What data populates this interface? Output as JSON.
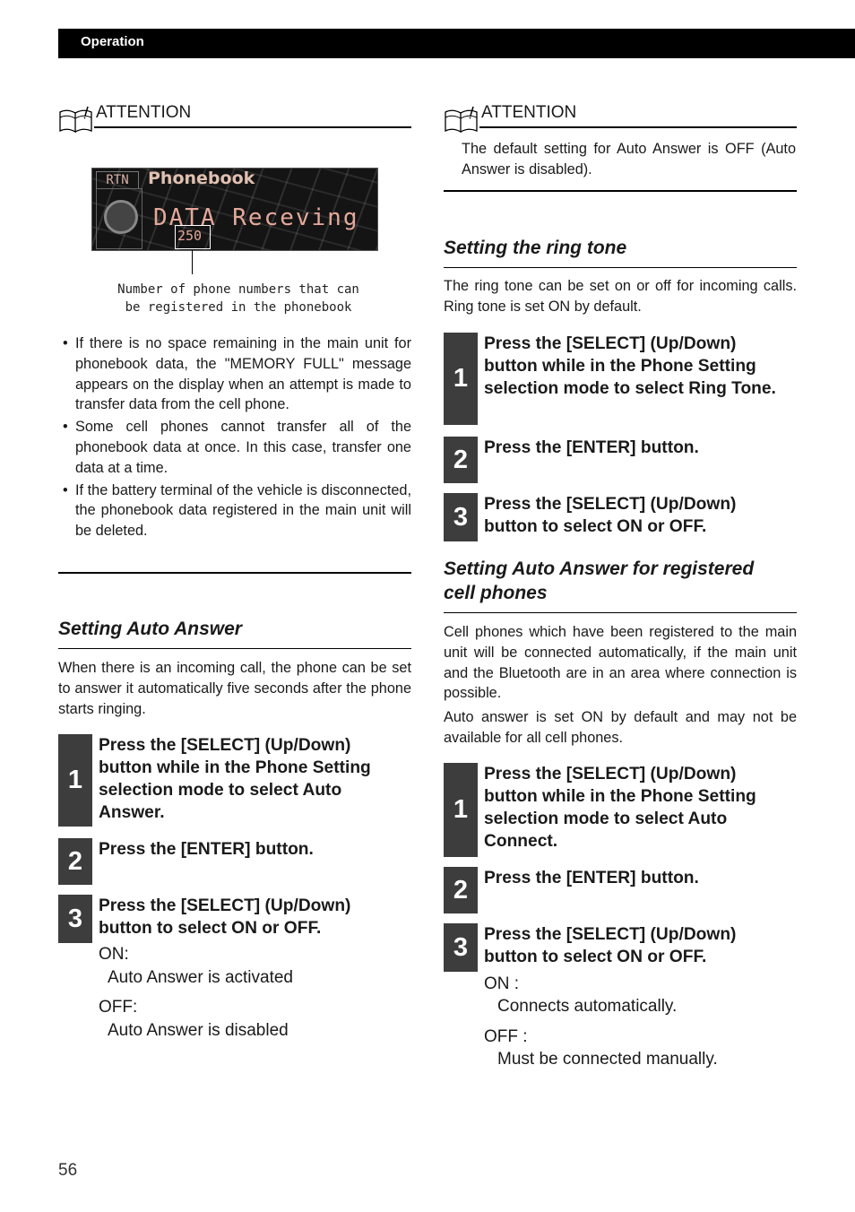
{
  "header": {
    "section": "Operation"
  },
  "left": {
    "attention1": {
      "label": "ATTENTION",
      "display": {
        "rtn": "RTN",
        "title": "Phonebook",
        "message": "DATA Receving",
        "count": "250"
      },
      "caption_line1": "Number of phone numbers that can",
      "caption_line2": "be registered in the phonebook",
      "bullets": [
        "If there is no space remaining in the main unit for phonebook data, the \"MEMORY FULL\" message appears on the display when an attempt is made to transfer data from the cell phone.",
        "Some cell phones cannot transfer all of the phonebook data at once. In this case, transfer one data at a time.",
        "If the battery terminal of the vehicle is disconnected, the phonebook data registered in the main unit will be deleted."
      ]
    },
    "auto_answer": {
      "title": "Setting Auto Answer",
      "intro": "When there is an incoming call, the phone can be set to answer it automatically five seconds after the phone starts ringing.",
      "steps": [
        {
          "n": "1",
          "text": "Press the [SELECT] (Up/Down) button while in the Phone Setting selection mode to select Auto Answer."
        },
        {
          "n": "2",
          "text": "Press the [ENTER] button."
        },
        {
          "n": "3",
          "text": "Press the [SELECT] (Up/Down) button to select ON or OFF."
        }
      ],
      "on_label": "ON:",
      "on_desc": "Auto Answer is activated",
      "off_label": "OFF:",
      "off_desc": "Auto Answer is disabled"
    }
  },
  "right": {
    "attention2": {
      "label": "ATTENTION",
      "text": "The default setting for Auto Answer is OFF (Auto Answer is disabled)."
    },
    "ring_tone": {
      "title": "Setting the ring tone",
      "intro": "The ring tone can be set on or off for incoming calls. Ring tone is set ON by default.",
      "steps": [
        {
          "n": "1",
          "text": "Press the [SELECT] (Up/Down) button while in the Phone Setting selection mode to select Ring Tone."
        },
        {
          "n": "2",
          "text": "Press the [ENTER] button."
        },
        {
          "n": "3",
          "text": "Press the [SELECT] (Up/Down) button to select ON or OFF."
        }
      ]
    },
    "auto_connect": {
      "title_line1": "Setting Auto Answer for registered",
      "title_line2": "cell phones",
      "intro1": "Cell phones which have been registered to the main unit will be connected automatically, if the main unit and the Bluetooth are in an area where connection is possible.",
      "intro2": "Auto answer is set ON by default and may not be available for all cell phones.",
      "steps": [
        {
          "n": "1",
          "text": "Press the [SELECT] (Up/Down) button while in the Phone Setting selection mode to select Auto Connect."
        },
        {
          "n": "2",
          "text": "Press the [ENTER] button."
        },
        {
          "n": "3",
          "text": "Press the [SELECT] (Up/Down) button to select ON or OFF."
        }
      ],
      "on_label": "ON :",
      "on_desc": "Connects automatically.",
      "off_label": "OFF :",
      "off_desc": "Must be connected manually."
    }
  },
  "footer": {
    "page_number": "56"
  }
}
